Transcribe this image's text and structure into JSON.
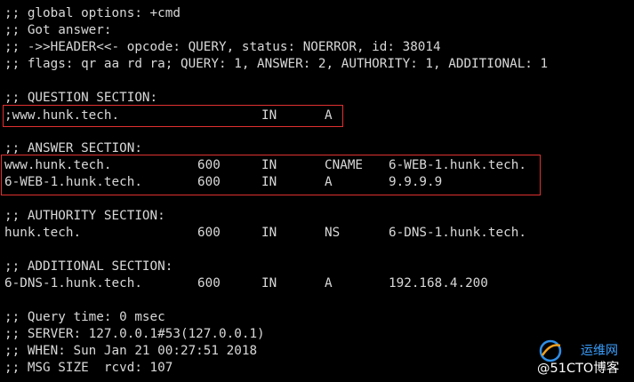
{
  "header_lines": [
    ";; global options: +cmd",
    ";; Got answer:",
    ";; ->>HEADER<<- opcode: QUERY, status: NOERROR, id: 38014",
    ";; flags: qr aa rd ra; QUERY: 1, ANSWER: 2, AUTHORITY: 1, ADDITIONAL: 1"
  ],
  "question": {
    "heading": ";; QUESTION SECTION:",
    "name": ";www.hunk.tech.",
    "class": "IN",
    "type": "A"
  },
  "answer": {
    "heading": ";; ANSWER SECTION:",
    "records": [
      {
        "name": "www.hunk.tech.",
        "ttl": "600",
        "class": "IN",
        "type": "CNAME",
        "data": "6-WEB-1.hunk.tech."
      },
      {
        "name": "6-WEB-1.hunk.tech.",
        "ttl": "600",
        "class": "IN",
        "type": "A",
        "data": "9.9.9.9"
      }
    ]
  },
  "authority": {
    "heading": ";; AUTHORITY SECTION:",
    "records": [
      {
        "name": "hunk.tech.",
        "ttl": "600",
        "class": "IN",
        "type": "NS",
        "data": "6-DNS-1.hunk.tech."
      }
    ]
  },
  "additional": {
    "heading": ";; ADDITIONAL SECTION:",
    "records": [
      {
        "name": "6-DNS-1.hunk.tech.",
        "ttl": "600",
        "class": "IN",
        "type": "A",
        "data": "192.168.4.200"
      }
    ]
  },
  "footer_lines": [
    ";; Query time: 0 msec",
    ";; SERVER: 127.0.0.1#53(127.0.0.1)",
    ";; WHEN: Sun Jan 21 00:27:51 2018",
    ";; MSG SIZE  rcvd: 107"
  ],
  "watermark": {
    "site_cn": "运维网",
    "blog": "@51CTO博客"
  },
  "colors": {
    "background": "#000000",
    "text": "#d8d8d8",
    "highlight_box": "#e03030"
  }
}
